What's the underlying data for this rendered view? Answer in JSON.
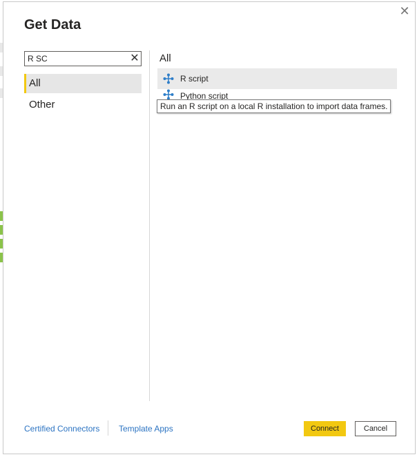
{
  "dialog": {
    "title": "Get Data",
    "close_icon": "close-icon"
  },
  "search": {
    "value": "R SC",
    "clear_icon": "clear-x-icon"
  },
  "categories": [
    {
      "label": "All",
      "selected": true
    },
    {
      "label": "Other",
      "selected": false
    }
  ],
  "list": {
    "title": "All",
    "items": [
      {
        "label": "R script",
        "icon": "script-connector-icon"
      },
      {
        "label": "Python script",
        "icon": "script-connector-icon"
      }
    ]
  },
  "tooltip": {
    "text": "Run an R script on a local R installation to import data frames."
  },
  "footer": {
    "certified_connectors": "Certified Connectors",
    "template_apps": "Template Apps",
    "connect": "Connect",
    "cancel": "Cancel"
  },
  "colors": {
    "accent": "#f2c811",
    "link": "#2b73c2",
    "icon_blue": "#2e7ec9"
  }
}
